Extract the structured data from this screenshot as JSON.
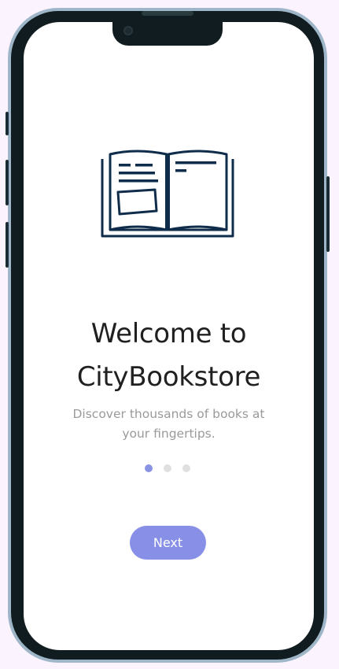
{
  "onboarding": {
    "illustration_icon": "open-book-icon",
    "title_line_1": "Welcome to",
    "title_line_2": "CityBookstore",
    "subtitle_line_1": "Discover thousands of books at",
    "subtitle_line_2": "your fingertips.",
    "pagination": {
      "total_pages": 3,
      "current_page": 1
    },
    "next_label": "Next"
  },
  "colors": {
    "accent": "#8790e6",
    "active_dot": "#8a93e3",
    "inactive_dot": "#e0e0e0",
    "title_text": "#202020",
    "subtitle_text": "#9a9a9a",
    "book_stroke": "#0f2d4a",
    "page_background": "#fbf3fd"
  }
}
